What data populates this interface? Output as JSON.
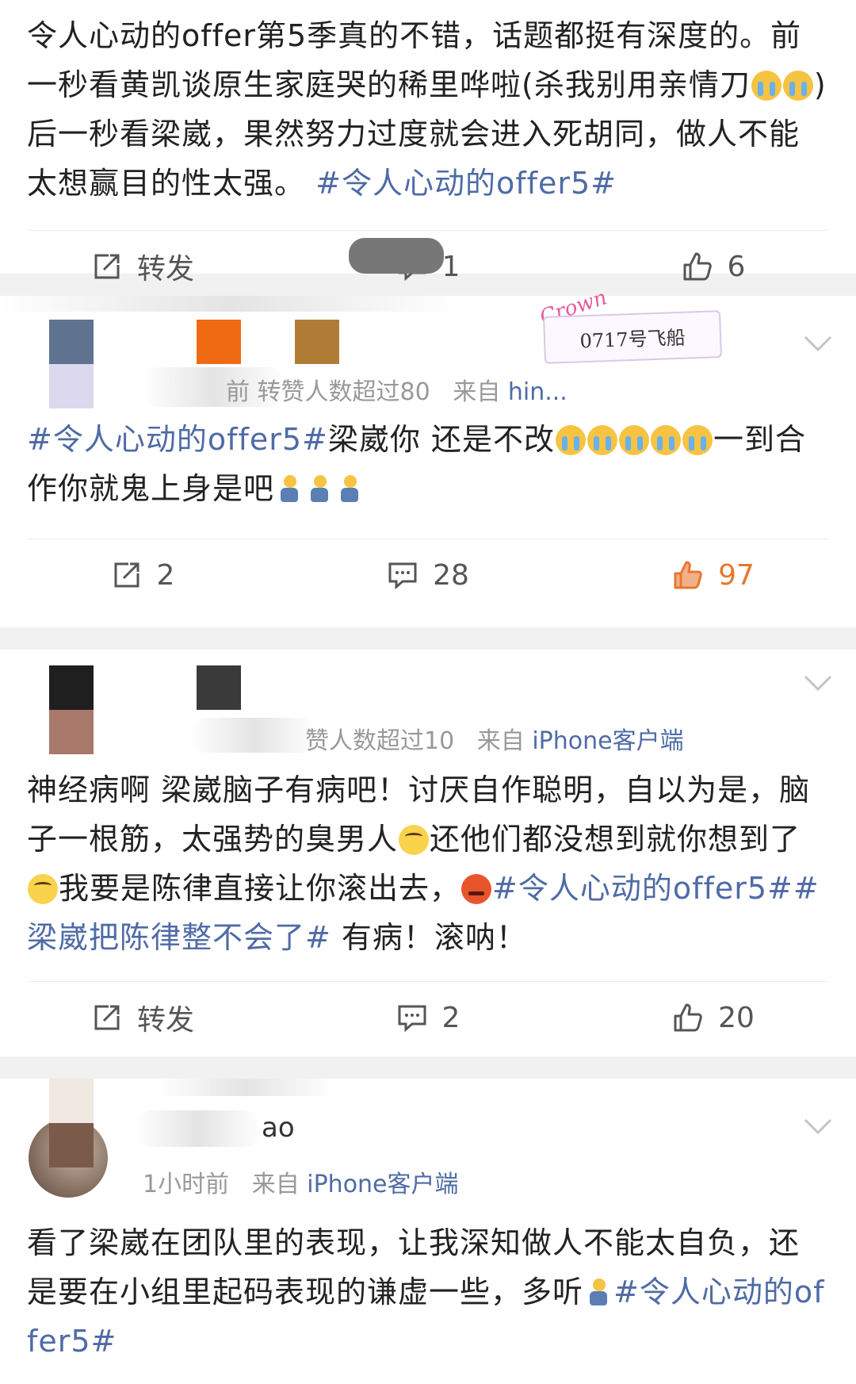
{
  "posts": [
    {
      "text": {
        "a": "令人心动的offer第5季真的不错，话题都挺有深度的。前一秒看黄凯谈原生家庭哭的稀里哗啦(杀我别用亲情刀",
        "b": ") 后一秒看梁崴，果然努力过度就会进入死胡同，做人不能太想赢目的性太强。",
        "tag": "#令人心动的offer5#"
      },
      "actions": {
        "repost": "转发",
        "comments": "1",
        "likes": "6"
      }
    },
    {
      "meta": {
        "stats": "前 转赞人数超过80",
        "from_label": "来自",
        "source": "hin..."
      },
      "badge": {
        "crown": "Crown",
        "text": "0717号飞船"
      },
      "text": {
        "tag": "#令人心动的offer5#",
        "a": "梁崴你 还是不改",
        "b": "一到合作你就鬼上身是吧"
      },
      "actions": {
        "repost": "2",
        "comments": "28",
        "likes": "97"
      }
    },
    {
      "meta": {
        "stats": "赞人数超过10",
        "from_label": "来自",
        "source": "iPhone客户端"
      },
      "text": {
        "a": "神经病啊 梁崴脑子有病吧！讨厌自作聪明，自以为是，脑子一根筋，太强势的臭男人",
        "b": "还他们都没想到就你想到了",
        "c": "我要是陈律直接让你滚出去，",
        "tag1": "#令人心动的offer5#",
        "tag2": "#梁崴把陈律整不会了#",
        "d": " 有病！滚呐！"
      },
      "actions": {
        "repost": "转发",
        "comments": "2",
        "likes": "20"
      }
    },
    {
      "meta": {
        "name": "ao",
        "time": "1小时前",
        "from_label": "来自",
        "source": "iPhone客户端"
      },
      "text": {
        "a": "看了梁崴在团队里的表现，让我深知做人不能太自负，还是要在小组里起码表现的谦虚一些，多听",
        "tag": "#令人心动的offer5#"
      }
    }
  ],
  "colors": {
    "link": "#4f6ba6",
    "liked": "#e8772e",
    "separator": "#f1f1f1"
  }
}
